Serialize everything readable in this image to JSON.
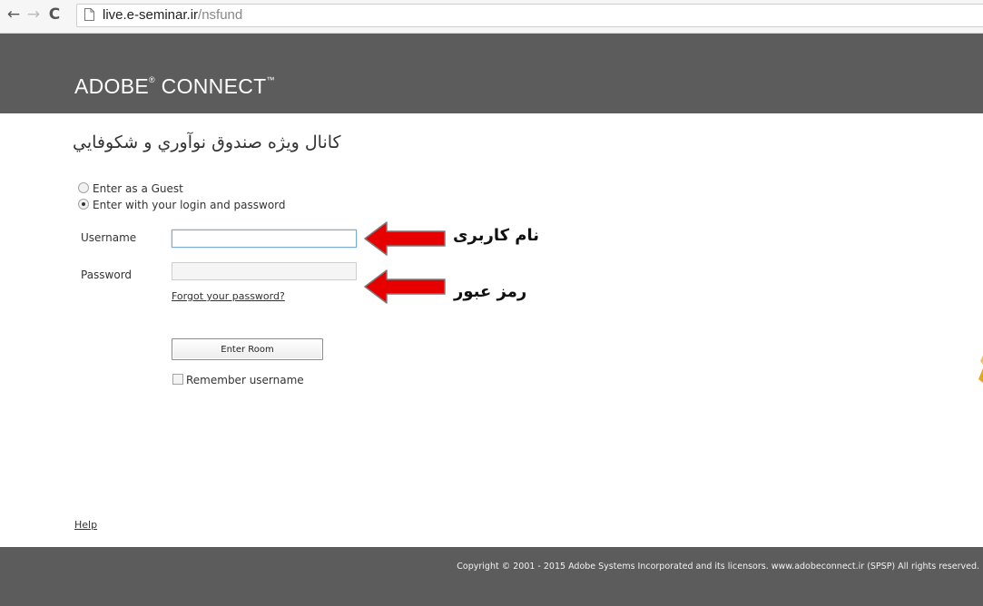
{
  "browser": {
    "url_host": "live.e-seminar.ir",
    "url_path": "/nsfund",
    "icons": [
      "back-arrow-icon",
      "forward-arrow-icon",
      "reload-icon",
      "page-icon"
    ]
  },
  "header": {
    "brand_main": "ADOBE",
    "brand_reg": "®",
    "brand_second": " CONNECT",
    "brand_tm": "™",
    "background": "#5c5c5c"
  },
  "room": {
    "title": "كانال ويژه صندوق نوآوري و شكوفايي"
  },
  "login": {
    "option_guest": "Enter as a Guest",
    "option_login": "Enter with your login and password",
    "selected_option": "login",
    "username_label": "Username",
    "username_value": "",
    "password_label": "Password",
    "password_value": "",
    "forgot_link": "Forgot your password?",
    "enter_button": "Enter Room",
    "remember_label": "Remember username",
    "remember_checked": false
  },
  "annotations": {
    "username_note": "نام کاربری",
    "password_note": "رمز عبور",
    "arrow_color": "#e60000"
  },
  "footer": {
    "help": "Help",
    "copyright": "Copyright © 2001 - 2015 Adobe Systems Incorporated and its licensors. www.adobeconnect.ir (SPSP) All rights reserved."
  }
}
